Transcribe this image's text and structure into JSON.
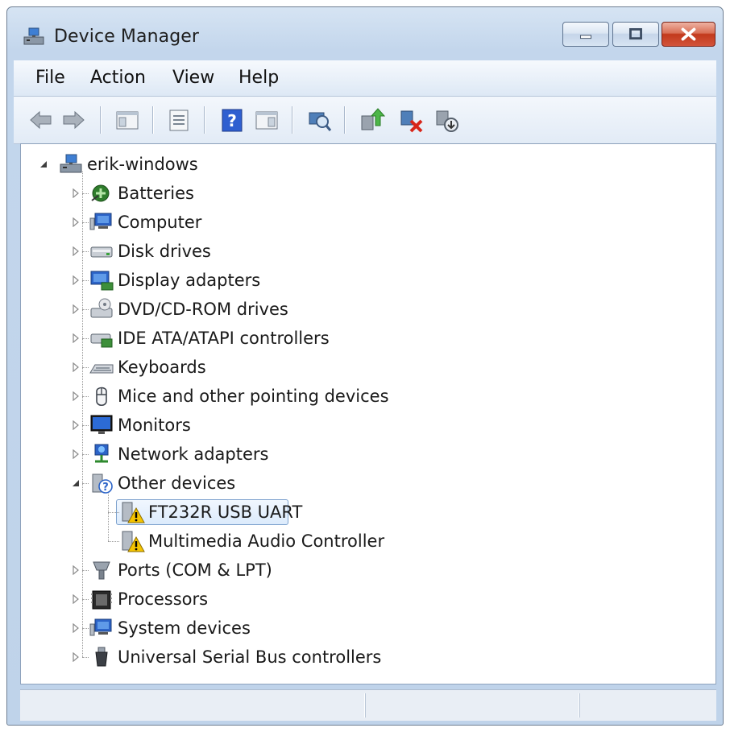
{
  "window": {
    "title": "Device Manager",
    "icon": "computer-tree-icon",
    "controls": [
      "minimize-icon",
      "maximize-icon",
      "close-icon"
    ]
  },
  "menu": [
    "File",
    "Action",
    "View",
    "Help"
  ],
  "toolbar": [
    "back-arrow-icon",
    "forward-arrow-icon",
    "show-hide-console-tree-icon",
    "properties-icon",
    "help-icon",
    "show-hide-action-pane-icon",
    "scan-for-hardware-changes-icon",
    "update-driver-icon",
    "uninstall-icon",
    "disable-icon"
  ],
  "tree": {
    "root": {
      "label": "erik-windows",
      "icon": "computer-root-icon",
      "expanded": true
    },
    "categories": [
      {
        "label": "Batteries",
        "icon": "battery-icon",
        "expanded": false
      },
      {
        "label": "Computer",
        "icon": "computer-icon",
        "expanded": false
      },
      {
        "label": "Disk drives",
        "icon": "disk-drive-icon",
        "expanded": false
      },
      {
        "label": "Display adapters",
        "icon": "display-adapter-icon",
        "expanded": false
      },
      {
        "label": "DVD/CD-ROM drives",
        "icon": "dvd-drive-icon",
        "expanded": false
      },
      {
        "label": "IDE ATA/ATAPI controllers",
        "icon": "ide-controller-icon",
        "expanded": false
      },
      {
        "label": "Keyboards",
        "icon": "keyboard-icon",
        "expanded": false
      },
      {
        "label": "Mice and other pointing devices",
        "icon": "mouse-icon",
        "expanded": false
      },
      {
        "label": "Monitors",
        "icon": "monitor-icon",
        "expanded": false
      },
      {
        "label": "Network adapters",
        "icon": "network-adapter-icon",
        "expanded": false
      },
      {
        "label": "Other devices",
        "icon": "unknown-device-icon",
        "expanded": true,
        "children": [
          {
            "label": "FT232R USB UART",
            "icon": "warning-device-icon",
            "selected": true
          },
          {
            "label": "Multimedia Audio Controller",
            "icon": "warning-device-icon",
            "selected": false
          }
        ]
      },
      {
        "label": "Ports (COM & LPT)",
        "icon": "port-icon",
        "expanded": false
      },
      {
        "label": "Processors",
        "icon": "processor-icon",
        "expanded": false
      },
      {
        "label": "System devices",
        "icon": "system-devices-icon",
        "expanded": false
      },
      {
        "label": "Universal Serial Bus controllers",
        "icon": "usb-icon",
        "expanded": false
      }
    ]
  },
  "colors": {
    "chrome": "#c3d6ec",
    "selection_border": "#7da2ce",
    "selection_fill": "#dcebfc",
    "close_button": "#c2391c",
    "warning": "#f5c400"
  }
}
